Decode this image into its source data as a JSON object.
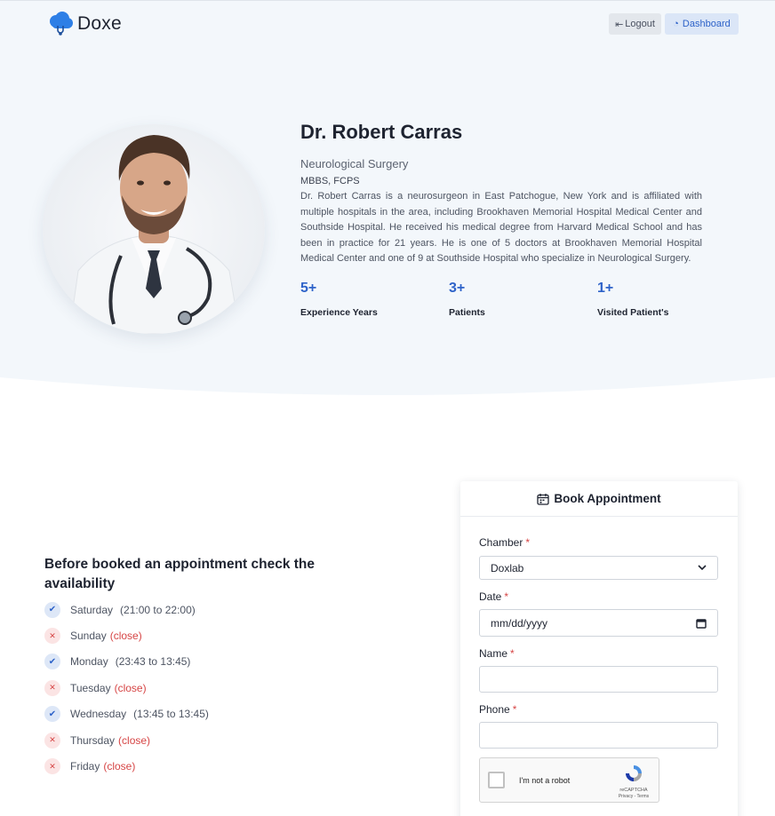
{
  "header": {
    "brand": "Doxe",
    "logout_label": "Logout",
    "dashboard_label": "Dashboard"
  },
  "profile": {
    "name": "Dr. Robert Carras",
    "specialty": "Neurological Surgery",
    "degree": "MBBS, FCPS",
    "bio": "Dr. Robert Carras is a neurosurgeon in East Patchogue, New York and is affiliated with multiple hospitals in the area, including Brookhaven Memorial Hospital Medical Center and Southside Hospital. He received his medical degree from Harvard Medical School and has been in practice for 21 years. He is one of 5 doctors at Brookhaven Memorial Hospital Medical Center and one of 9 at Southside Hospital who specialize in Neurological Surgery.",
    "stats": [
      {
        "value": "5+",
        "label": "Experience Years"
      },
      {
        "value": "3+",
        "label": "Patients"
      },
      {
        "value": "1+",
        "label": "Visited Patient's"
      }
    ]
  },
  "availability": {
    "title": "Before booked an appointment check the availability",
    "days": [
      {
        "day": "Saturday",
        "time": "(21:00 to 22:00)",
        "open": true
      },
      {
        "day": "Sunday",
        "time": "(close)",
        "open": false
      },
      {
        "day": "Monday",
        "time": "(23:43 to 13:45)",
        "open": true
      },
      {
        "day": "Tuesday",
        "time": "(close)",
        "open": false
      },
      {
        "day": "Wednesday",
        "time": "(13:45 to 13:45)",
        "open": true
      },
      {
        "day": "Thursday",
        "time": "(close)",
        "open": false
      },
      {
        "day": "Friday",
        "time": "(close)",
        "open": false
      }
    ]
  },
  "booking": {
    "title": "Book Appointment",
    "required_mark": "*",
    "chamber_label": "Chamber",
    "chamber_value": "Doxlab",
    "date_label": "Date",
    "date_placeholder": "mm/dd/yyyy",
    "name_label": "Name",
    "phone_label": "Phone",
    "captcha_text": "I'm not a robot",
    "captcha_brand": "reCAPTCHA",
    "captcha_terms": "Privacy - Terms"
  },
  "colors": {
    "accent": "#2e63c9",
    "danger": "#d64545",
    "hero_bg": "#f3f7fb"
  }
}
